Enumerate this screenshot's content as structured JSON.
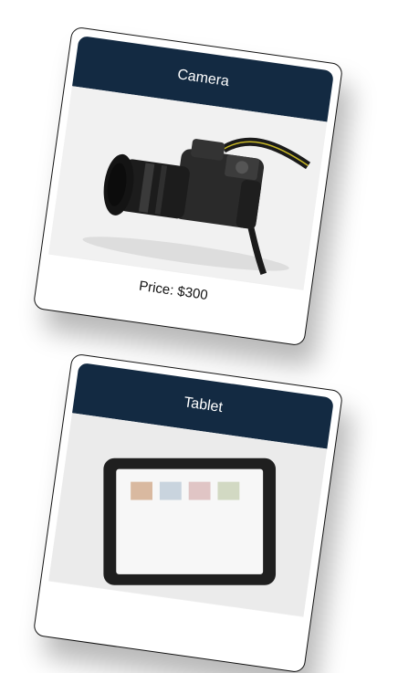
{
  "products": [
    {
      "title": "Camera",
      "price": "Price: $300",
      "image_icon": "camera-photo"
    },
    {
      "title": "Tablet",
      "image_icon": "tablet-photo"
    }
  ],
  "colors": {
    "header": "#132a42",
    "card_border": "#111111",
    "background": "#ffffff"
  }
}
